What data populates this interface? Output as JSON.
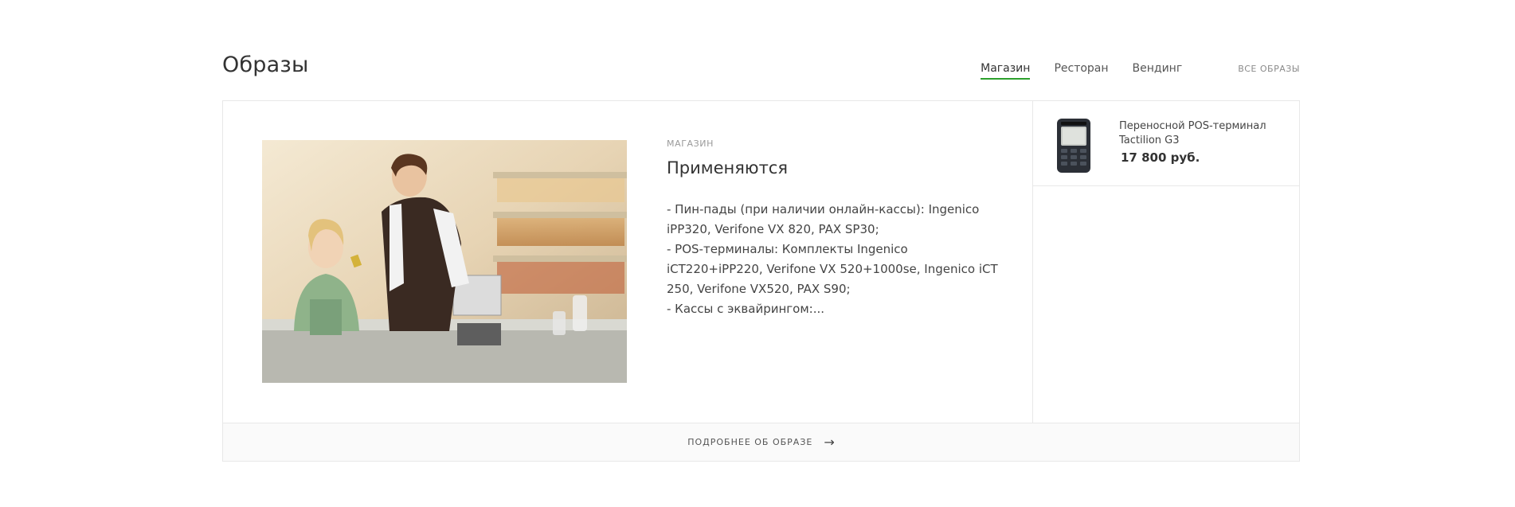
{
  "section": {
    "title": "Образы"
  },
  "tabs": [
    {
      "label": "Магазин",
      "active": true
    },
    {
      "label": "Ресторан",
      "active": false
    },
    {
      "label": "Вендинг",
      "active": false
    }
  ],
  "all_link": "ВСЕ ОБРАЗЫ",
  "card": {
    "category": "МАГАЗИН",
    "heading": "Применяются",
    "description_lines": [
      "- Пин-пады (при наличии онлайн-кассы): Ingenico iPP320, Verifone VX 820, PAX SP30;",
      "- POS-терминалы: Комплекты Ingenico iCT220+iPP220, Verifone VX 520+1000se, Ingenico iCT 250, Verifone VX520, PAX S90;",
      "- Кассы с эквайрингом:..."
    ],
    "footer_label": "ПОДРОБНЕЕ ОБ ОБРАЗЕ",
    "footer_icon": "arrow-right-icon"
  },
  "product": {
    "name": "Переносной POS-терминал Tactilion G3",
    "price": "17 800 руб."
  },
  "colors": {
    "accent": "#2ca02c",
    "border": "#e8e8e8"
  }
}
